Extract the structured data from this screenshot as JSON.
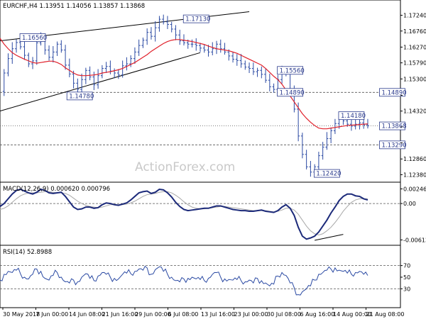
{
  "header": {
    "main": "EURCHF,H4  1.13951 1.14056 1.13857 1.13868",
    "macd": "MACD(12,26,9) 0.000620 0.000796",
    "rsi": "RSI(14) 52.8988"
  },
  "watermark": "ActionForex.com",
  "colors": {
    "price": "#2b4aa3",
    "ma": "#e0202a",
    "trendline": "#000000",
    "macd_line": "#1c2a7a",
    "macd_signal": "#a8a8a8",
    "rsi_line": "#2b4aa3",
    "level_line": "#555555"
  },
  "chart_data": [
    {
      "type": "line",
      "title": "EURCHF,H4",
      "ylim": [
        1.1226,
        1.1736
      ],
      "y_ticks": [
        "1.17240",
        "1.16760",
        "1.16270",
        "1.15790",
        "1.15300",
        "1.14800",
        "1.14320",
        "1.13840",
        "1.13350",
        "1.12860",
        "1.12380"
      ],
      "x_ticks": [
        "30 May 2018",
        "7 Jun 00:00",
        "14 Jun 08:00",
        "21 Jun 16:00",
        "29 Jun 00:00",
        "6 Jul 08:00",
        "13 Jul 16:00",
        "23 Jul 00:00",
        "30 Jul 08:00",
        "6 Aug 16:00",
        "14 Aug 00:00",
        "21 Aug 08:00"
      ],
      "x": [
        0,
        2,
        4,
        6,
        8,
        10,
        12,
        14,
        16,
        18,
        20,
        22,
        24,
        26,
        28,
        30,
        32,
        34,
        36,
        38,
        40,
        42,
        44,
        46,
        48,
        50,
        52,
        54,
        56,
        58,
        60,
        62,
        64,
        66,
        68,
        70,
        72,
        74,
        76,
        78,
        80,
        82,
        84,
        86,
        88,
        90,
        92,
        94,
        96,
        98,
        100,
        102,
        104,
        106,
        108,
        110,
        112,
        114,
        116,
        118,
        120,
        122,
        124,
        126,
        128,
        130,
        132,
        134,
        136,
        138,
        140,
        142,
        144,
        146,
        148,
        150,
        152,
        154,
        156,
        158,
        160,
        162,
        164,
        166,
        168,
        170,
        172,
        174,
        176,
        178,
        180
      ],
      "series": [
        {
          "name": "price",
          "values": [
            1.1492,
            1.1548,
            1.1592,
            1.1622,
            1.1641,
            1.1628,
            1.1602,
            1.1576,
            1.1585,
            1.164,
            1.1652,
            1.1618,
            1.1596,
            1.1612,
            1.1636,
            1.1618,
            1.1572,
            1.1545,
            1.1517,
            1.1498,
            1.1528,
            1.1556,
            1.1536,
            1.1512,
            1.154,
            1.1562,
            1.1568,
            1.1554,
            1.1548,
            1.1542,
            1.157,
            1.1576,
            1.1592,
            1.1612,
            1.1632,
            1.1648,
            1.1672,
            1.166,
            1.1686,
            1.1712,
            1.1704,
            1.1696,
            1.1682,
            1.1664,
            1.1646,
            1.164,
            1.1636,
            1.1636,
            1.1632,
            1.1624,
            1.1618,
            1.1612,
            1.1622,
            1.1636,
            1.1622,
            1.1612,
            1.16,
            1.159,
            1.1586,
            1.1576,
            1.1566,
            1.1562,
            1.1552,
            1.1556,
            1.1544,
            1.1526,
            1.1506,
            1.1498,
            1.1528,
            1.1552,
            1.1546,
            1.1494,
            1.1438,
            1.1356,
            1.13,
            1.1262,
            1.1246,
            1.1262,
            1.1296,
            1.1322,
            1.1348,
            1.1372,
            1.1394,
            1.141,
            1.1402,
            1.1392,
            1.1386,
            1.1392,
            1.1396,
            1.139,
            1.1387
          ]
        },
        {
          "name": "ma",
          "values": [
            1.1654,
            1.1636,
            1.1622,
            1.161,
            1.1602,
            1.1596,
            1.159,
            1.1585,
            1.158,
            1.1578,
            1.158,
            1.1582,
            1.1584,
            1.1584,
            1.158,
            1.1574,
            1.1564,
            1.1556,
            1.1548,
            1.1542,
            1.154,
            1.154,
            1.1541,
            1.1542,
            1.1544,
            1.1548,
            1.155,
            1.1552,
            1.1555,
            1.1558,
            1.1562,
            1.1568,
            1.1574,
            1.158,
            1.1588,
            1.1596,
            1.1604,
            1.1614,
            1.1622,
            1.163,
            1.1638,
            1.1644,
            1.1648,
            1.165,
            1.165,
            1.1648,
            1.1646,
            1.1644,
            1.1641,
            1.1638,
            1.1635,
            1.163,
            1.1626,
            1.1622,
            1.162,
            1.1618,
            1.1616,
            1.1612,
            1.1608,
            1.1602,
            1.1596,
            1.159,
            1.1584,
            1.1578,
            1.1572,
            1.1562,
            1.155,
            1.1538,
            1.1528,
            1.1514,
            1.1496,
            1.1478,
            1.146,
            1.1442,
            1.1424,
            1.141,
            1.1398,
            1.1388,
            1.138,
            1.1378,
            1.1378,
            1.138,
            1.1382,
            1.1384,
            1.1386,
            1.1388,
            1.1389,
            1.139,
            1.1391,
            1.1392,
            1.1393
          ]
        }
      ],
      "trendlines": [
        {
          "x": [
            0,
            122
          ],
          "y": [
            1.1646,
            1.1735
          ]
        },
        {
          "x": [
            0,
            98
          ],
          "y": [
            1.1432,
            1.161
          ]
        }
      ],
      "levels": [
        1.1489,
        1.13868,
        1.1329
      ],
      "annotations": [
        {
          "text": "1.16560",
          "x": 16,
          "y": 1.1656
        },
        {
          "text": "1.14780",
          "x": 39,
          "y": 1.1478
        },
        {
          "text": "1.17130",
          "x": 96,
          "y": 1.1713
        },
        {
          "text": "1.15560",
          "x": 142,
          "y": 1.1556
        },
        {
          "text": "1.14890",
          "x": 142,
          "y": 1.1489
        },
        {
          "text": "1.14180",
          "x": 172,
          "y": 1.1418
        },
        {
          "text": "1.12420",
          "x": 160,
          "y": 1.1242
        },
        {
          "text": "1.14890",
          "x": 192,
          "y": 1.1489
        },
        {
          "text": "1.13868",
          "x": 192,
          "y": 1.13868
        },
        {
          "text": "1.13290",
          "x": 192,
          "y": 1.1329
        }
      ]
    },
    {
      "type": "line",
      "title": "MACD(12,26,9) 0.000620 0.000796",
      "ylim": [
        -0.0068,
        0.003
      ],
      "y_ticks": [
        "0.002469",
        "0.00",
        "-0.006136"
      ],
      "x": [
        0,
        2,
        4,
        6,
        8,
        10,
        12,
        14,
        16,
        18,
        20,
        22,
        24,
        26,
        28,
        30,
        32,
        34,
        36,
        38,
        40,
        42,
        44,
        46,
        48,
        50,
        52,
        54,
        56,
        58,
        60,
        62,
        64,
        66,
        68,
        70,
        72,
        74,
        76,
        78,
        80,
        82,
        84,
        86,
        88,
        90,
        92,
        94,
        96,
        98,
        100,
        102,
        104,
        106,
        108,
        110,
        112,
        114,
        116,
        118,
        120,
        122,
        124,
        126,
        128,
        130,
        132,
        134,
        136,
        138,
        140,
        142,
        144,
        146,
        148,
        150,
        152,
        154,
        156,
        158,
        160,
        162,
        164,
        166,
        168,
        170,
        172,
        174,
        176,
        178,
        180
      ],
      "series": [
        {
          "name": "macd",
          "values": [
            -0.0005,
            0.0,
            0.0008,
            0.0016,
            0.0022,
            0.0024,
            0.0021,
            0.0018,
            0.0016,
            0.0019,
            0.0024,
            0.0022,
            0.0018,
            0.0017,
            0.0018,
            0.0019,
            0.0012,
            0.0003,
            -0.0006,
            -0.001,
            -0.0009,
            -0.0006,
            -0.0006,
            -0.0008,
            -0.0007,
            -0.0002,
            0.0001,
            0.0,
            -0.0002,
            -0.0003,
            -0.0001,
            0.0001,
            0.0006,
            0.0012,
            0.0018,
            0.002,
            0.0021,
            0.0017,
            0.0019,
            0.0024,
            0.0023,
            0.0018,
            0.0011,
            0.0002,
            -0.0005,
            -0.001,
            -0.0012,
            -0.0011,
            -0.001,
            -0.0009,
            -0.0008,
            -0.0008,
            -0.0006,
            -0.0004,
            -0.0004,
            -0.0006,
            -0.0008,
            -0.001,
            -0.0011,
            -0.0012,
            -0.0012,
            -0.0013,
            -0.0013,
            -0.0012,
            -0.0011,
            -0.0013,
            -0.0014,
            -0.0015,
            -0.0012,
            -0.0006,
            -0.0002,
            -0.0008,
            -0.002,
            -0.004,
            -0.0055,
            -0.006,
            -0.0058,
            -0.0055,
            -0.0048,
            -0.0038,
            -0.0028,
            -0.0016,
            -0.0006,
            0.0005,
            0.0012,
            0.0016,
            0.0016,
            0.0013,
            0.0012,
            0.0008,
            0.0006
          ]
        },
        {
          "name": "signal",
          "values": [
            -0.001,
            -0.0008,
            -0.0004,
            0.0002,
            0.0008,
            0.0013,
            0.0016,
            0.0018,
            0.0018,
            0.0018,
            0.0019,
            0.002,
            0.002,
            0.0019,
            0.0018,
            0.0018,
            0.0017,
            0.0014,
            0.0009,
            0.0004,
            0.0,
            -0.0003,
            -0.0005,
            -0.0006,
            -0.0007,
            -0.0006,
            -0.0004,
            -0.0002,
            -0.0002,
            -0.0002,
            -0.0002,
            -0.0001,
            0.0001,
            0.0004,
            0.0008,
            0.0012,
            0.0015,
            0.0016,
            0.0017,
            0.0019,
            0.002,
            0.002,
            0.0018,
            0.0014,
            0.0009,
            0.0003,
            -0.0002,
            -0.0006,
            -0.0008,
            -0.0009,
            -0.0009,
            -0.0008,
            -0.0007,
            -0.0006,
            -0.0005,
            -0.0005,
            -0.0006,
            -0.0007,
            -0.0008,
            -0.0009,
            -0.001,
            -0.0011,
            -0.0012,
            -0.0012,
            -0.0012,
            -0.0012,
            -0.0013,
            -0.0014,
            -0.0013,
            -0.0011,
            -0.0008,
            -0.0008,
            -0.0011,
            -0.0018,
            -0.0028,
            -0.0038,
            -0.0046,
            -0.0051,
            -0.0053,
            -0.0051,
            -0.0046,
            -0.004,
            -0.0032,
            -0.0023,
            -0.0013,
            -0.0005,
            0.0002,
            0.0006,
            0.0008,
            0.0008,
            0.0008
          ]
        }
      ],
      "trendlines": [
        {
          "x": [
            154,
            168
          ],
          "y": [
            -0.0062,
            -0.0052
          ]
        }
      ]
    },
    {
      "type": "line",
      "title": "RSI(14) 52.8988",
      "ylim": [
        0,
        100
      ],
      "y_ticks": [
        "70",
        "50",
        "30"
      ],
      "levels": [
        70,
        30
      ],
      "x": [
        0,
        2,
        4,
        6,
        8,
        10,
        12,
        14,
        16,
        18,
        20,
        22,
        24,
        26,
        28,
        30,
        32,
        34,
        36,
        38,
        40,
        42,
        44,
        46,
        48,
        50,
        52,
        54,
        56,
        58,
        60,
        62,
        64,
        66,
        68,
        70,
        72,
        74,
        76,
        78,
        80,
        82,
        84,
        86,
        88,
        90,
        92,
        94,
        96,
        98,
        100,
        102,
        104,
        106,
        108,
        110,
        112,
        114,
        116,
        118,
        120,
        122,
        124,
        126,
        128,
        130,
        132,
        134,
        136,
        138,
        140,
        142,
        144,
        146,
        148,
        150,
        152,
        154,
        156,
        158,
        160,
        162,
        164,
        166,
        168,
        170,
        172,
        174,
        176,
        178,
        180
      ],
      "series": [
        {
          "name": "rsi",
          "values": [
            45,
            55,
            60,
            58,
            62,
            56,
            50,
            47,
            55,
            64,
            60,
            48,
            45,
            53,
            58,
            50,
            42,
            40,
            45,
            42,
            50,
            56,
            48,
            44,
            52,
            58,
            55,
            50,
            48,
            47,
            55,
            57,
            56,
            60,
            64,
            62,
            66,
            55,
            63,
            68,
            60,
            55,
            50,
            44,
            42,
            47,
            48,
            50,
            47,
            46,
            44,
            48,
            55,
            58,
            50,
            47,
            46,
            45,
            46,
            44,
            42,
            45,
            40,
            48,
            44,
            40,
            35,
            38,
            52,
            58,
            53,
            40,
            32,
            20,
            25,
            30,
            35,
            45,
            55,
            58,
            62,
            64,
            66,
            62,
            60,
            57,
            55,
            58,
            60,
            55,
            52.9
          ]
        }
      ]
    }
  ]
}
